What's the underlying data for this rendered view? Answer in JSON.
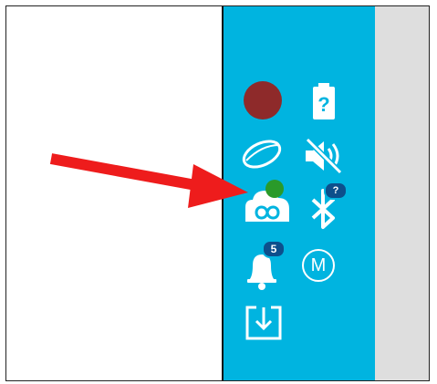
{
  "colors": {
    "taskbar": "#00b4e0",
    "record": "#8e2a2a",
    "status_ok": "#2a9a2a",
    "badge": "#0d4f8c",
    "arrow": "#ee1c1c",
    "right_pane": "#dedede"
  },
  "tray": {
    "record_icon": "red-record-icon",
    "battery_icon": "battery-unknown-icon",
    "battery_symbol": "?",
    "contact_icon": "contact-lens-icon",
    "mute_icon": "speaker-muted-icon",
    "cloud_icon": "cloud-sync-icon",
    "cloud_status": "synced",
    "bluetooth_icon": "bluetooth-icon",
    "bluetooth_badge": "?",
    "bell_icon": "notifications-bell-icon",
    "bell_badge": "5",
    "m_icon_letter": "M",
    "download_icon": "download-tray-icon"
  },
  "annotation": {
    "arrow": "red-arrow-pointing-to-cloud-icon"
  }
}
